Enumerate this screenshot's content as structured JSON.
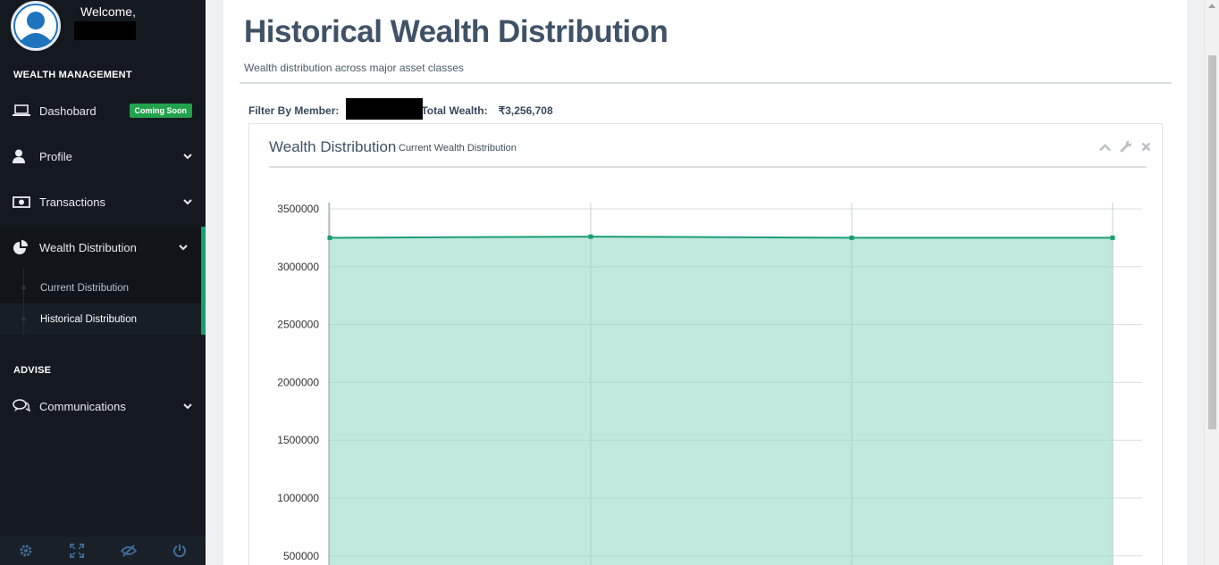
{
  "user": {
    "welcome": "Welcome,"
  },
  "sidebar": {
    "section_wealth": "WEALTH MANAGEMENT",
    "section_advise": "ADVISE",
    "items": [
      {
        "label": "Dashobard",
        "icon": "laptop-icon",
        "badge": "Coming Soon"
      },
      {
        "label": "Profile",
        "icon": "user-icon"
      },
      {
        "label": "Transactions",
        "icon": "money-icon"
      },
      {
        "label": "Wealth Distribution",
        "icon": "pie-chart-icon"
      },
      {
        "label": "Communications",
        "icon": "comments-icon"
      }
    ],
    "sub_items": [
      {
        "label": "Current Distribution"
      },
      {
        "label": "Historical Distribution"
      }
    ],
    "footer_icons": [
      "settings-icon",
      "fullscreen-icon",
      "hide-icon",
      "power-icon"
    ]
  },
  "header": {
    "title": "Historical Wealth Distribution",
    "subtitle": "Wealth distribution across major asset classes"
  },
  "filter": {
    "member_label": "Filter By Member:",
    "total_label": "Total Wealth:",
    "total_value": "₹3,256,708"
  },
  "widget": {
    "title": "Wealth Distribution",
    "subtitle": "Current Wealth Distribution"
  },
  "colors": {
    "line": "#1a9e72",
    "area": "#c0e8df",
    "accent": "#18a06f",
    "badge": "#23a24d"
  },
  "chart_data": {
    "type": "area",
    "title": "",
    "xlabel": "",
    "ylabel": "",
    "ylim": [
      0,
      3500000
    ],
    "yticks": [
      500000,
      1000000,
      1500000,
      2000000,
      2500000,
      3000000,
      3500000
    ],
    "series": [
      {
        "values": [
          3250000,
          3260000,
          3250000,
          3250000
        ]
      }
    ]
  }
}
